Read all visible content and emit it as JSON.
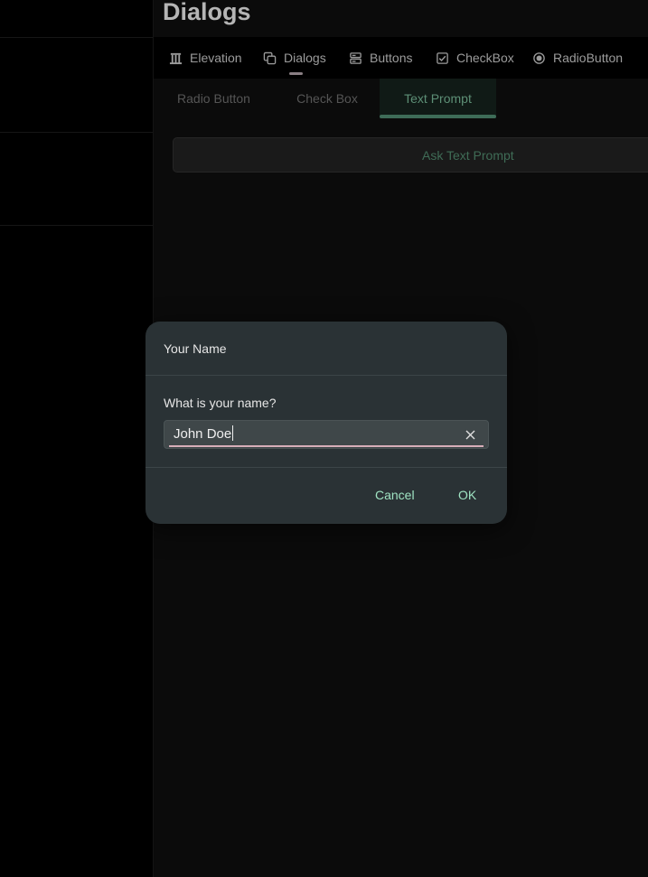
{
  "page": {
    "title": "Dialogs"
  },
  "nav": {
    "items": [
      {
        "label": "Elevation",
        "icon": "elevation-icon"
      },
      {
        "label": "Dialogs",
        "icon": "dialogs-icon",
        "active": true
      },
      {
        "label": "Buttons",
        "icon": "buttons-icon"
      },
      {
        "label": "CheckBox",
        "icon": "checkbox-icon"
      },
      {
        "label": "RadioButton",
        "icon": "radiobutton-icon"
      }
    ]
  },
  "subtabs": {
    "items": [
      {
        "label": "Radio Button"
      },
      {
        "label": "Check Box"
      },
      {
        "label": "Text Prompt",
        "selected": true
      }
    ]
  },
  "main": {
    "ask_button_label": "Ask Text Prompt"
  },
  "dialog": {
    "title": "Your Name",
    "prompt_label": "What is your name?",
    "input_value": "John Doe",
    "cancel_label": "Cancel",
    "ok_label": "OK"
  },
  "colors": {
    "accent": "#9fe3c2",
    "tab_accent": "#3e6c58",
    "input_underline": "#d7aeb9",
    "dialog_bg": "#2a3235"
  }
}
